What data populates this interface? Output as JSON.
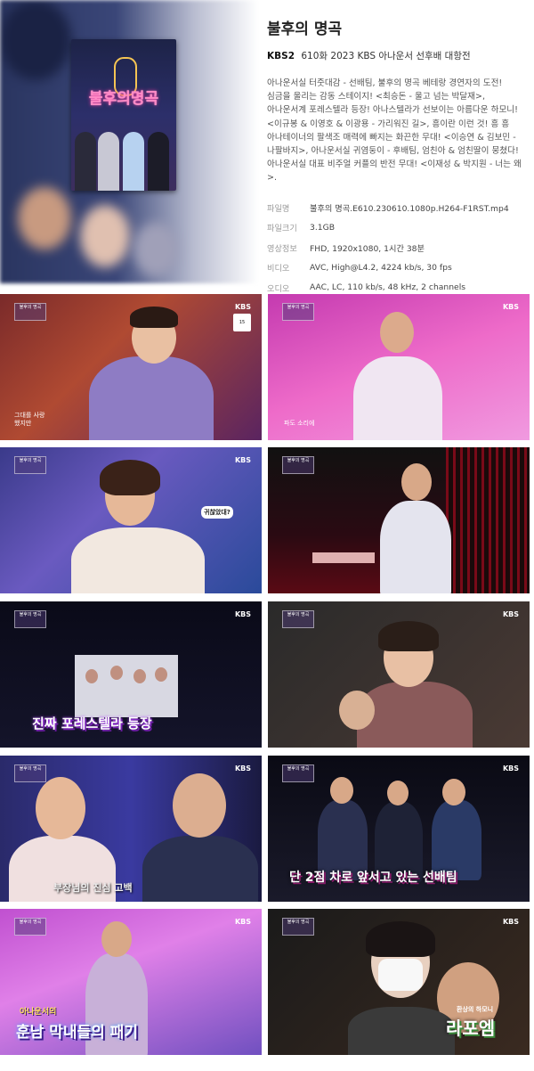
{
  "show": {
    "title": "불후의 명곡",
    "channel": "KBS2",
    "episode": "610화 2023 KBS 아나운서 선후배 대항전",
    "poster_title": "불후의명곡",
    "description": "아나운서실 터줏대감 - 선배팀, 불후의 명곡 베테랑 경연자의 도전! 심금을 울리는 감동 스테이지! <최승돈 - 울고 넘는 박달재>, 아나운서계 포레스텔라 등장! 아나스텔라가 선보이는 아름다운 하모니! <이규봉 & 이영호 & 이광용 - 가리워진 길>, 흥이란 이런 것! 흥 흥 아나테이너의 팔색조 매력에 빠지는 화끈한 무대! <이승연 & 김보민 - 나팔바지>, 아나운서실 귀염둥이 - 후배팀, 엄친아 & 엄친딸이 뭉쳤다! 아나운서실 대표 비주얼 커플의 반전 무대! <이재성 & 박지원 - 너는 왜>."
  },
  "meta": [
    {
      "key": "파일명",
      "value": "불후의 명곡.E610.230610.1080p.H264-F1RST.mp4"
    },
    {
      "key": "파일크기",
      "value": "3.1GB"
    },
    {
      "key": "영상정보",
      "value": "FHD, 1920x1080, 1시간 38분"
    },
    {
      "key": "비디오",
      "value": "AVC, High@L4.2, 4224 kb/s, 30 fps"
    },
    {
      "key": "오디오",
      "value": "AAC, LC, 110 kb/s, 48 kHz, 2 channels"
    }
  ],
  "screenshots": {
    "kbs": "KBS",
    "badge": "불후의 명곡",
    "rating": "15",
    "captions": {
      "s1": "그대를 사랑했지만",
      "s2": "파도 소리에",
      "s3": "귀찮았대?",
      "s5": "진짜 포레스텔라 등장",
      "s7": "부장님의 진심 고백",
      "s8": "단 2점 차로 앞서고 있는 선배팀",
      "s8_tag": "선배팀",
      "s9_top": "아나운서의",
      "s9_main": "훈남 막내들의 패기",
      "s10_small": "환상의 하모니",
      "s10_main": "라포엠"
    }
  },
  "colors": {
    "accent_pink": "#ff8ac6",
    "caption_yellow": "#ffe25a"
  }
}
